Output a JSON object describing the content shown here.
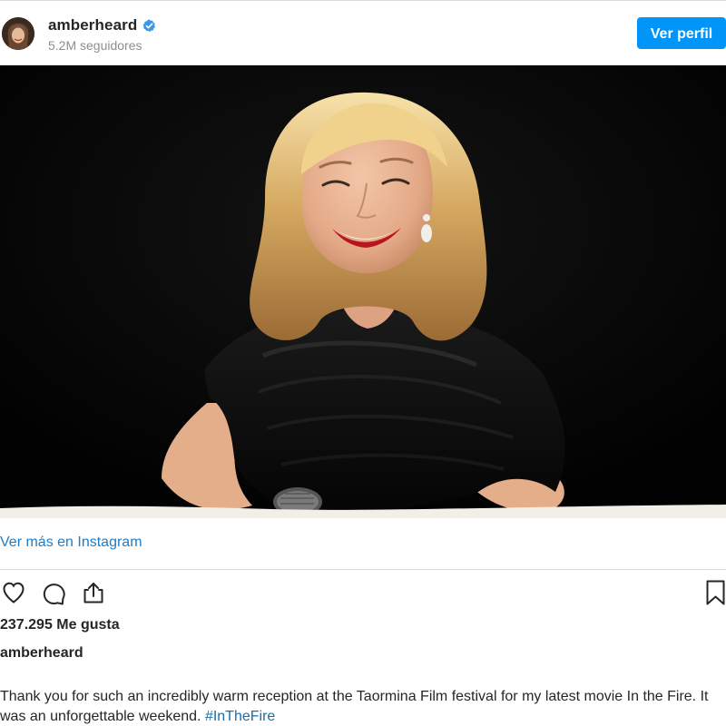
{
  "header": {
    "username": "amberheard",
    "followers": "5.2M seguidores",
    "profile_button": "Ver perfil"
  },
  "link": {
    "view_more": "Ver más en Instagram"
  },
  "post": {
    "likes": "237.295 Me gusta",
    "caption_username": "amberheard",
    "caption_text": "Thank you for such an incredibly warm reception at the Taormina Film festival for my latest movie In the Fire. It was an unforgettable weekend. ",
    "caption_hashtag": "#InTheFire"
  },
  "icons": {
    "verified": "verified-badge-icon",
    "like": "heart-icon",
    "comment": "comment-icon",
    "share": "share-icon",
    "save": "bookmark-icon"
  },
  "colors": {
    "primary_button": "#0095f6",
    "link": "#1c7dc9",
    "muted_text": "#8e8e8e",
    "text": "#262626"
  }
}
